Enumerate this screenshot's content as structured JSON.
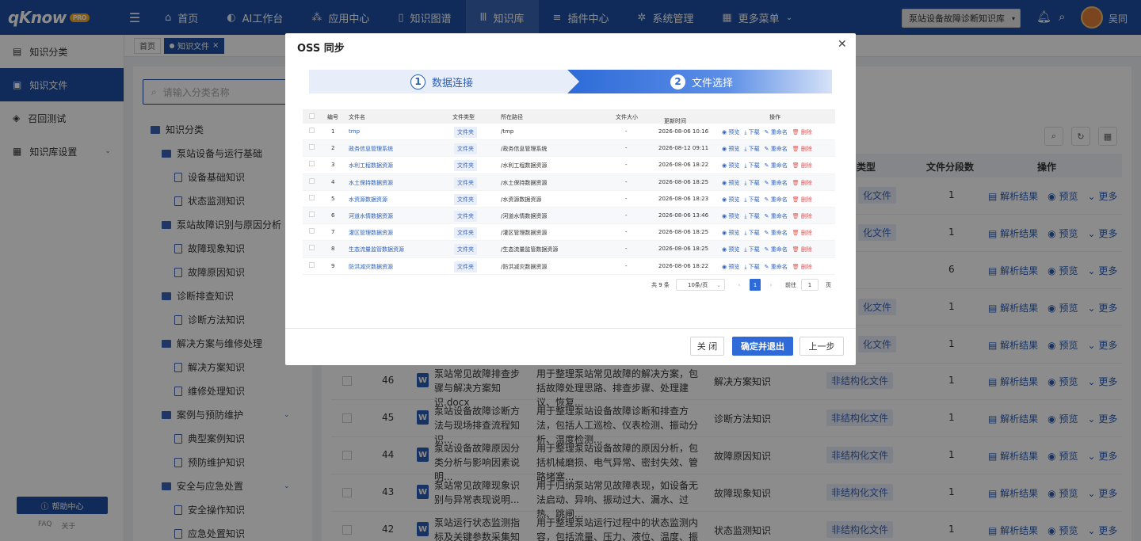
{
  "app": {
    "logo": "qKnow",
    "logo_badge": "PRO"
  },
  "topnav": {
    "items": [
      {
        "label": "首页",
        "icon": "home-icon"
      },
      {
        "label": "AI工作台",
        "icon": "ai-icon"
      },
      {
        "label": "应用中心",
        "icon": "app-icon"
      },
      {
        "label": "知识图谱",
        "icon": "book-icon"
      },
      {
        "label": "知识库",
        "icon": "library-icon"
      },
      {
        "label": "插件中心",
        "icon": "list-icon"
      },
      {
        "label": "系统管理",
        "icon": "gear-icon"
      },
      {
        "label": "更多菜单",
        "icon": "grid-icon"
      }
    ],
    "active_index": 4,
    "kb_select": "泵站设备故障诊断知识库",
    "username": "吴同"
  },
  "sidebar": {
    "items": [
      {
        "label": "知识分类"
      },
      {
        "label": "知识文件"
      },
      {
        "label": "召回测试"
      },
      {
        "label": "知识库设置"
      }
    ],
    "help": "帮助中心",
    "faq": "FAQ",
    "about": "关于"
  },
  "tabs": {
    "home": "首页",
    "current": "知识文件"
  },
  "tree": {
    "search_placeholder": "请输入分类名称",
    "nodes": [
      {
        "label": "知识分类",
        "level": 0,
        "kind": "folder"
      },
      {
        "label": "泵站设备与运行基础",
        "level": 1,
        "kind": "folder"
      },
      {
        "label": "设备基础知识",
        "level": 2,
        "kind": "doc"
      },
      {
        "label": "状态监测知识",
        "level": 2,
        "kind": "doc"
      },
      {
        "label": "泵站故障识别与原因分析",
        "level": 1,
        "kind": "folder"
      },
      {
        "label": "故障现象知识",
        "level": 2,
        "kind": "doc"
      },
      {
        "label": "故障原因知识",
        "level": 2,
        "kind": "doc"
      },
      {
        "label": "诊断排查知识",
        "level": 1,
        "kind": "folder"
      },
      {
        "label": "诊断方法知识",
        "level": 2,
        "kind": "doc"
      },
      {
        "label": "解决方案与维修处理",
        "level": 1,
        "kind": "folder"
      },
      {
        "label": "解决方案知识",
        "level": 2,
        "kind": "doc"
      },
      {
        "label": "维修处理知识",
        "level": 2,
        "kind": "doc"
      },
      {
        "label": "案例与预防维护",
        "level": 1,
        "kind": "folder"
      },
      {
        "label": "典型案例知识",
        "level": 2,
        "kind": "doc"
      },
      {
        "label": "预防维护知识",
        "level": 2,
        "kind": "doc"
      },
      {
        "label": "安全与应急处置",
        "level": 1,
        "kind": "folder"
      },
      {
        "label": "安全操作知识",
        "level": 2,
        "kind": "doc"
      },
      {
        "label": "应急处置知识",
        "level": 2,
        "kind": "doc"
      }
    ]
  },
  "main": {
    "headers": {
      "type": "类型",
      "seg": "文件分段数",
      "ops": "操作"
    },
    "partial_rows": [
      {
        "ftype": "化文件",
        "seg": "1"
      },
      {
        "ftype": "化文件",
        "seg": "1"
      },
      {
        "ftype": "",
        "seg": "6"
      },
      {
        "ftype": "化文件",
        "seg": "1"
      },
      {
        "ftype": "化文件",
        "seg": "1"
      }
    ],
    "rows": [
      {
        "num": "46",
        "name": "泵站常见故障排查步骤与解决方案知识.docx",
        "desc": "用于整理泵站常见故障的解决方案，包括故障处理思路、排查步骤、处理建议、恢复...",
        "cat": "解决方案知识",
        "ftype": "非结构化文件",
        "seg": "1"
      },
      {
        "num": "45",
        "name": "泵站设备故障诊断方法与现场排查流程知识...",
        "desc": "用于整理泵站设备故障诊断和排查方法，包括人工巡检、仪表检测、振动分析、温度检测...",
        "cat": "诊断方法知识",
        "ftype": "非结构化文件",
        "seg": "1"
      },
      {
        "num": "44",
        "name": "泵站设备故障原因分类分析与影响因素说明...",
        "desc": "用于整理泵站设备故障的原因分析，包括机械磨损、电气异常、密封失效、管路堵塞...",
        "cat": "故障原因知识",
        "ftype": "非结构化文件",
        "seg": "1"
      },
      {
        "num": "43",
        "name": "泵站常见故障现象识别与异常表现说明...",
        "desc": "用于归纳泵站常见故障表现，如设备无法启动、异响、振动过大、漏水、过热、跳闸...",
        "cat": "故障现象知识",
        "ftype": "非结构化文件",
        "seg": "1"
      },
      {
        "num": "42",
        "name": "泵站运行状态监测指标及关键参数采集知识...",
        "desc": "用于整理泵站运行过程中的状态监测内容，包括流量、压力、液位、温度、振动、电...",
        "cat": "状态监测知识",
        "ftype": "非结构化文件",
        "seg": "1"
      }
    ],
    "ops": {
      "parse": "解析结果",
      "preview": "预览",
      "more": "更多"
    }
  },
  "modal": {
    "title": "OSS 同步",
    "steps": [
      {
        "num": "1",
        "label": "数据连接"
      },
      {
        "num": "2",
        "label": "文件选择"
      }
    ],
    "columns": {
      "no": "编号",
      "name": "文件名",
      "type": "文件类型",
      "path": "所在路径",
      "size": "文件大小",
      "updated": "更新时间",
      "ops": "操作"
    },
    "rows": [
      {
        "no": "1",
        "name": "tmp",
        "type": "文件夹",
        "path": "/tmp",
        "size": "-",
        "updated": "2026-08-06 10:16"
      },
      {
        "no": "2",
        "name": "政务信息管理系统",
        "type": "文件夹",
        "path": "/政务信息管理系统",
        "size": "-",
        "updated": "2026-08-12 09:11"
      },
      {
        "no": "3",
        "name": "水利工程数据资源",
        "type": "文件夹",
        "path": "/水利工程数据资源",
        "size": "-",
        "updated": "2026-08-06 18:22"
      },
      {
        "no": "4",
        "name": "水土保持数据资源",
        "type": "文件夹",
        "path": "/水土保持数据资源",
        "size": "-",
        "updated": "2026-08-06 18:25"
      },
      {
        "no": "5",
        "name": "水资源数据资源",
        "type": "文件夹",
        "path": "/水资源数据资源",
        "size": "-",
        "updated": "2026-08-06 18:23"
      },
      {
        "no": "6",
        "name": "河道水情数据资源",
        "type": "文件夹",
        "path": "/河道水情数据资源",
        "size": "-",
        "updated": "2026-08-06 13:46"
      },
      {
        "no": "7",
        "name": "灌区管理数据资源",
        "type": "文件夹",
        "path": "/灌区管理数据资源",
        "size": "-",
        "updated": "2026-08-06 18:25"
      },
      {
        "no": "8",
        "name": "生态流量监管数据资源",
        "type": "文件夹",
        "path": "/生态流量监管数据资源",
        "size": "-",
        "updated": "2026-08-06 18:25"
      },
      {
        "no": "9",
        "name": "防洪减灾数据资源",
        "type": "文件夹",
        "path": "/防洪减灾数据资源",
        "size": "-",
        "updated": "2026-08-06 18:22"
      }
    ],
    "row_actions": {
      "preview": "预览",
      "download": "下载",
      "rename": "重命名",
      "delete": "删除"
    },
    "pager": {
      "total": "共 9 条",
      "page_size": "10条/页",
      "current": "1",
      "goto_label": "前往",
      "goto_value": "1",
      "page_unit": "页"
    },
    "buttons": {
      "close": "关 闭",
      "confirm": "确定并退出",
      "prev": "上一步"
    }
  }
}
